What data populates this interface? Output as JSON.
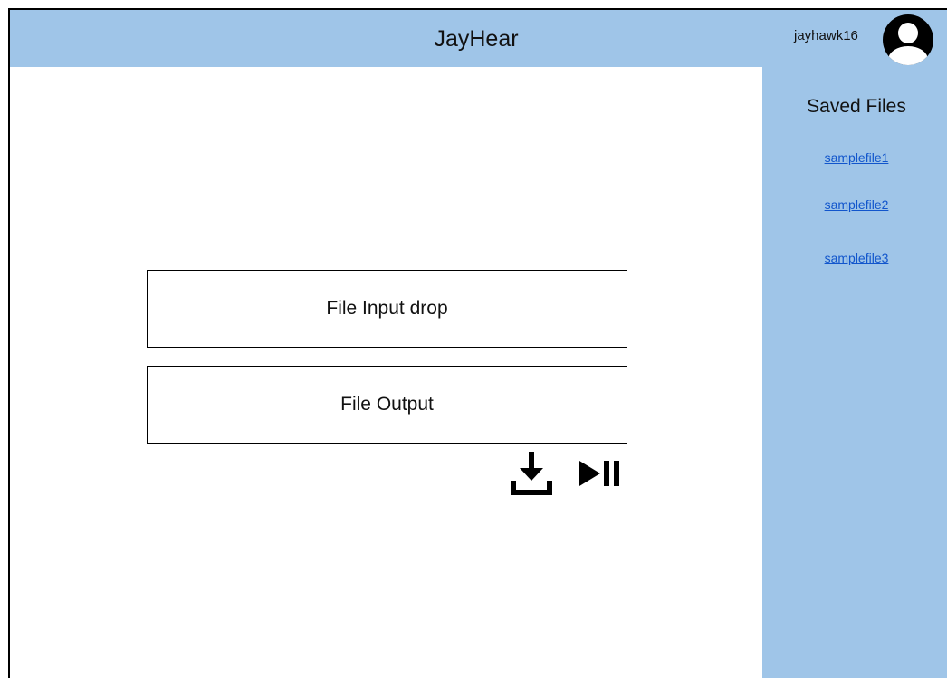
{
  "header": {
    "title": "JayHear",
    "username": "jayhawk16",
    "avatar_icon": "user-avatar-icon",
    "background": "#9fc5e8"
  },
  "sidebar": {
    "title": "Saved Files",
    "files": [
      {
        "label": "samplefile1"
      },
      {
        "label": "samplefile2"
      },
      {
        "label": "samplefile3"
      }
    ],
    "link_color": "#1155cc"
  },
  "main": {
    "input_drop_label": "File Input drop",
    "output_label": "File Output",
    "download_icon": "download-icon",
    "play_pause_icon": "play-pause-icon"
  }
}
